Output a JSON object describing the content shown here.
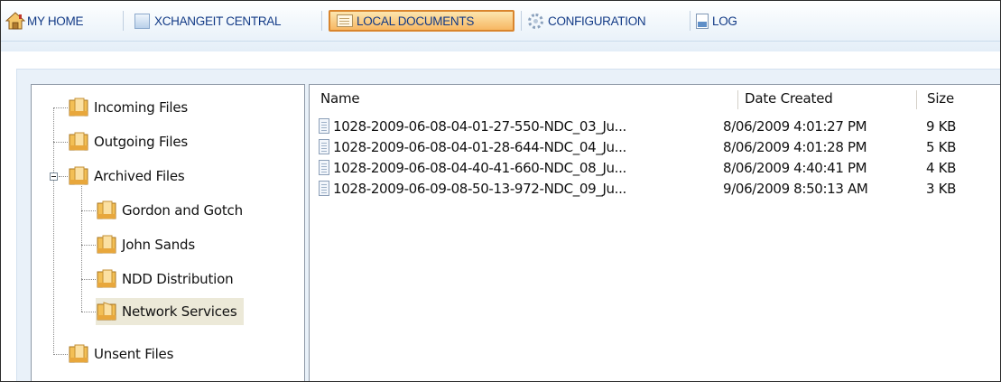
{
  "toolbar": {
    "tabs": [
      {
        "label": "MY HOME",
        "icon": "home-icon",
        "active": false
      },
      {
        "label": "XCHANGEIT CENTRAL",
        "icon": "central-icon",
        "active": false
      },
      {
        "label": "LOCAL DOCUMENTS",
        "icon": "documents-icon",
        "active": true
      },
      {
        "label": "CONFIGURATION",
        "icon": "gear-icon",
        "active": false
      },
      {
        "label": "LOG",
        "icon": "log-icon",
        "active": false
      }
    ]
  },
  "tree": {
    "items": [
      {
        "label": "Incoming Files",
        "icon": "folder-icon"
      },
      {
        "label": "Outgoing Files",
        "icon": "folder-icon"
      },
      {
        "label": "Archived Files",
        "icon": "folder-icon",
        "expanded": true
      },
      {
        "label": "Gordon and Gotch",
        "icon": "folder-icon"
      },
      {
        "label": "John Sands",
        "icon": "folder-icon"
      },
      {
        "label": "NDD Distribution",
        "icon": "folder-icon"
      },
      {
        "label": "Network Services",
        "icon": "folder-open-icon",
        "selected": true
      },
      {
        "label": "Unsent Files",
        "icon": "folder-icon"
      }
    ]
  },
  "files": {
    "columns": [
      "Name",
      "Date Created",
      "Size"
    ],
    "rows": [
      {
        "name": "1028-2009-06-08-04-01-27-550-NDC_03_Ju...",
        "date": "8/06/2009 4:01:27 PM",
        "size": "9 KB"
      },
      {
        "name": "1028-2009-06-08-04-01-28-644-NDC_04_Ju...",
        "date": "8/06/2009 4:01:28 PM",
        "size": "5 KB"
      },
      {
        "name": "1028-2009-06-08-04-40-41-660-NDC_08_Ju...",
        "date": "8/06/2009 4:40:41 PM",
        "size": "4 KB"
      },
      {
        "name": "1028-2009-06-09-08-50-13-972-NDC_09_Ju...",
        "date": "9/06/2009 8:50:13 AM",
        "size": "3 KB"
      }
    ]
  },
  "colors": {
    "tab_text": "#123a86",
    "active_tab_bg": "#f7b762",
    "active_tab_border": "#d9852d",
    "panel_bg": "#e9f1f9",
    "selected_item_bg": "#ece9d8",
    "folder": "#f0b848"
  }
}
